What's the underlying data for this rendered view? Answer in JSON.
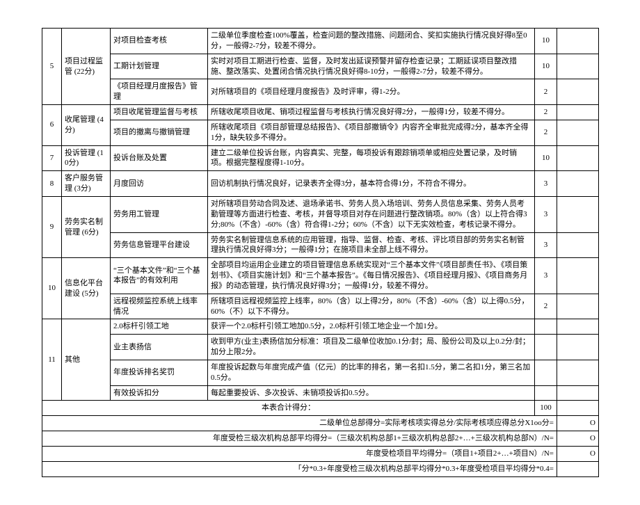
{
  "rows": [
    {
      "idx": "5",
      "cat": "项目过程监管 (22分)",
      "catRows": 3,
      "item": "对项目检查考核",
      "desc": "二级单位季度检查100%覆盖，检查问题的整改措施、问题闭合、奖扣实施执行情况良好得8至0分，一般得2-7分，较差不得分。",
      "score": "10",
      "res": ""
    },
    {
      "item": "工期计划管理",
      "desc": "实时对项目工期进行检查、监督，及时发出延误预警并留存检查记录；工期延误项目整改措施、整改落实、处置闭合情况执行情况良好得8-10分，一般得2-7分，较差不得分。",
      "score": "10",
      "res": ""
    },
    {
      "item": "《项目经理月度报告》管理",
      "desc": "对所辖项目的《项目经理月度报告》及时评审，得1-2分。",
      "score": "2",
      "res": ""
    },
    {
      "idx": "6",
      "cat": "收尾管理 (4分)",
      "catRows": 2,
      "item": "项目收尾管理监督与考核",
      "desc": "所辖收尾项目收尾、销项过程监督与考核执行情况良好得2分，一般得1分，较差不得分。",
      "score": "2",
      "res": ""
    },
    {
      "item": "项目的撤离与撤销管理",
      "desc": "所辖收尾项目《项目部管理总结报告》、《项目部撤销令》内容齐全审批完成得2分，基本齐全得1分，缺失较多不得分。",
      "score": "2",
      "res": ""
    },
    {
      "idx": "7",
      "cat": "投诉管理 (10分)",
      "catRows": 1,
      "item": "投诉台账及处置",
      "desc": "建立二级单位投诉台账，内容真实、完整，每项投诉有跟踪销项单或相应处置记录，及时销项。根据完整程度得1-10分。",
      "score": "10",
      "res": ""
    },
    {
      "idx": "8",
      "cat": "客户服务管理 (3分)",
      "catRows": 1,
      "item": "月度回访",
      "desc": "回访机制执行情况良好，记录表齐全得3分，基本符合得1分，不符合不得分。",
      "score": "3",
      "res": ""
    },
    {
      "idx": "9",
      "cat": "劳务实名制管理 (6分)",
      "catRows": 2,
      "item": "劳务用工管理",
      "desc": "对所辖项目劳动合同及述、退场承诺书、劳务人员入场培训、劳务人员信息采集、劳务人员考勤管理等方面进行检查、考核，并督导项目对存在问题进行整改销项。80%（含）以上符合得3分;80%（不含）-60%（含）符合得1-2分；60%（不含）以下无实效检查，考核记录不得分。",
      "score": "3",
      "res": ""
    },
    {
      "item": "劳务信息管理平台建设",
      "desc": "劳务实名制管理信息系统的应用管理，指导、监督、检查、考核、评比项目部的劳务实名制管理执行情况良好得3分；一般得1分；在施项目未全部上线不得分。",
      "score": "3",
      "res": ""
    },
    {
      "idx": "10",
      "cat": "信息化平台建设 (5分)",
      "catRows": 2,
      "item": "“三个基本文件”和“三个基本报告”的有效利用",
      "desc": "全部项目均运用企业建立的项目管理信息系统实现对“三个基本文件”《项目部责任书》、《项目策划书》、《项目实施计划》和“三个基本报告”。《每日情况报告》、《项目经理月报》、《项目商务月报》的动态管理，执行情况良好得3分；一般得1分，较差不得分。",
      "score": "3",
      "res": ""
    },
    {
      "item": "远程视频监控系统上线率情况",
      "desc": "所辖项目远程视频监控上线率，80%（含）以上得2分，80%（不含）-60%（含）以上得0.5分，60%（不）以下不得分。",
      "score": "2",
      "res": ""
    },
    {
      "idx": "11",
      "cat": "其他",
      "catRows": 4,
      "item": "2.0标杆引领工地",
      "desc": "获评一个2.0标杆引领工地加0.5分，2.0标杆引领工地企业一个加1分。",
      "score": "",
      "res": ""
    },
    {
      "item": "业主表扬信",
      "desc": "收到甲方(业主)表扬信加分标准：项目及二级单位收加0.1分/封；局、股份公司及以上0.2分/封；加分上限2分。",
      "score": "",
      "res": ""
    },
    {
      "item": "年度投诉排名奖罚",
      "desc": "年度投诉起数与年度完成产值（亿元）的比率的排名，第一名扣1.5分，第二名扣1分，第三名加0.5分。",
      "score": "",
      "res": ""
    },
    {
      "item": "有效投诉扣分",
      "desc": "每起重要投诉、多次投诉、未销项投诉扣0.5分。",
      "score": "",
      "res": ""
    }
  ],
  "totals": {
    "label": "本表合计得分：",
    "score": "100",
    "res": "",
    "formula1": "二级单位总部得分=实际考核项实得总分/实际考核项应得总分X1oo分=",
    "formula2": "年度受检三级次机构总部平均得分=（三级次机构总部1+三级次机构总部2+…+三级次机构总部N）/N=",
    "formula3": "年度受检项目平均得分=（项目1+项目2+…+项目N）/N=",
    "formula4": "「分*0.3+年度受检三级次机构总部平均得分*0.3+年度受检项目平均得分*0.4=",
    "o": "O"
  }
}
